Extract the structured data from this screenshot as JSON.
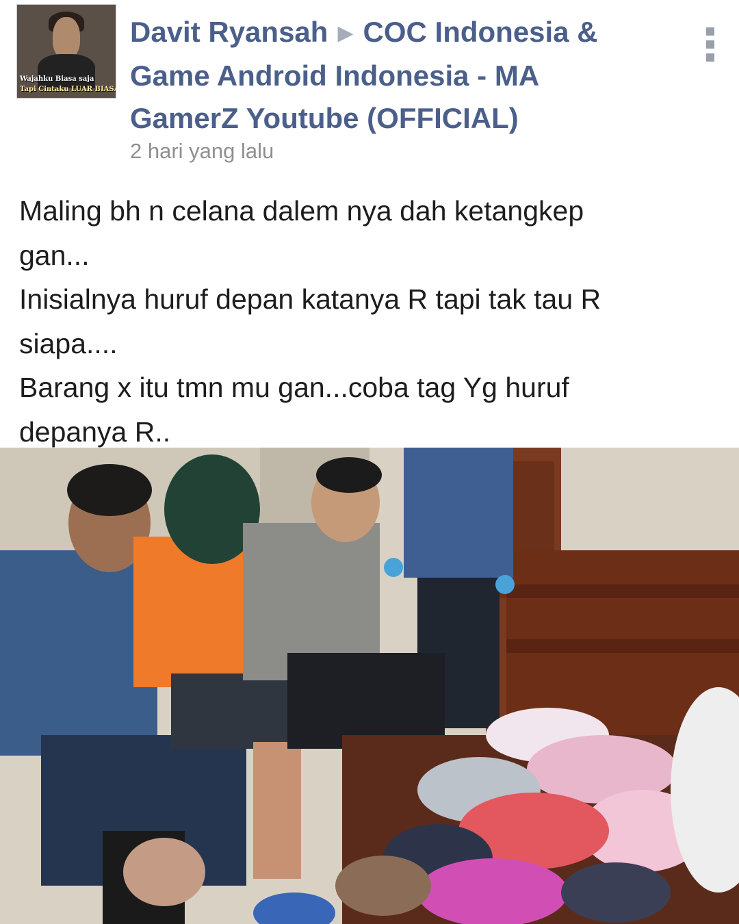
{
  "post": {
    "author": "Davit Ryansah",
    "group_line1": "COC Indonesia &",
    "group_line2": "Game Android Indonesia - MA",
    "group_line3": "GamerZ Youtube (OFFICIAL)",
    "timestamp": "2 hari yang lalu",
    "avatar_caption_line1": "Wajahku Biasa saja",
    "avatar_caption_line2": "Tapi Cintaku LUAR BIASA..!!",
    "text_lines": [
      "Maling bh n celana dalem nya dah ketangkep",
      "gan...",
      "Inisialnya huruf depan katanya R  tapi tak tau R",
      "siapa....",
      "Barang x itu tmn mu gan...coba tag Yg huruf",
      "depanya R.."
    ]
  },
  "icons": {
    "header_arrow": "▶",
    "menu": "vertical-ellipsis-icon"
  },
  "colors": {
    "author_blue": "#4b5f8b",
    "timestamp_gray": "#8f8f8f",
    "body_text": "#1d1d1d"
  }
}
